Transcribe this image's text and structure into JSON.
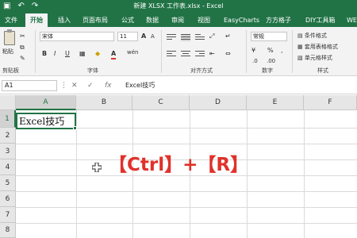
{
  "titlebar": {
    "title": "新建 XLSX 工作表.xlsx - Excel",
    "qat_icons": [
      "save-icon",
      "undo-icon",
      "redo-icon"
    ],
    "qat_glyphs": [
      "▣",
      "↶",
      "↷"
    ]
  },
  "tabs": [
    "文件",
    "开始",
    "插入",
    "页面布局",
    "公式",
    "数据",
    "审阅",
    "视图",
    "EasyCharts",
    "方方格子",
    "DIY工具箱",
    "WE"
  ],
  "ribbon": {
    "clipboard": {
      "paste_label": "粘贴",
      "group_label": "剪贴板"
    },
    "font": {
      "name": "宋体",
      "size": "11",
      "grow": "A",
      "shrink": "A",
      "bold": "B",
      "italic": "I",
      "underline": "U",
      "font_color": "A",
      "wen": "wén",
      "group_label": "字体"
    },
    "alignment": {
      "group_label": "对齐方式"
    },
    "number": {
      "format": "常规",
      "currency": "¥",
      "percent": "%",
      "comma": ",",
      "group_label": "数字"
    },
    "styles": {
      "conditional": "条件格式",
      "table_format": "套用表格格式",
      "cell_styles": "单元格样式",
      "group_label": "样式"
    }
  },
  "formula_bar": {
    "name_box": "A1",
    "cancel": "✕",
    "enter": "✓",
    "fx": "fx",
    "content": "Excel技巧"
  },
  "grid": {
    "columns": [
      "A",
      "B",
      "C",
      "D",
      "E",
      "F"
    ],
    "rows": [
      "1",
      "2",
      "3",
      "4",
      "5",
      "6",
      "7",
      "8"
    ],
    "a1_value": "Excel技巧"
  },
  "overlay_text": "【Ctrl】+【R】",
  "colors": {
    "excel_green": "#217346",
    "overlay_red": "#e0312a"
  }
}
